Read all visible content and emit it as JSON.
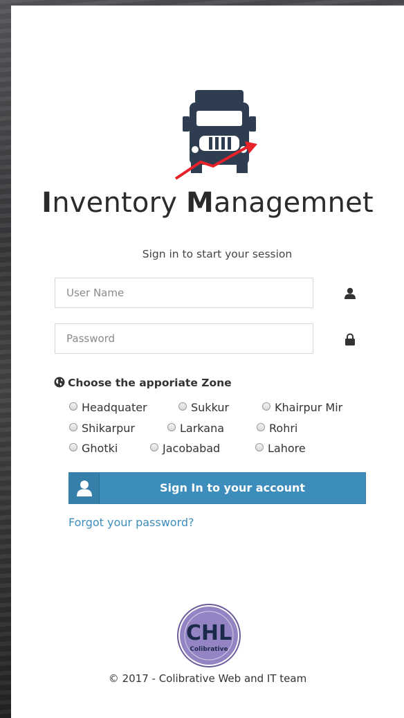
{
  "app": {
    "title_first_letter": "I",
    "title_first_rest": "nventory ",
    "title_second_letter": "M",
    "title_second_rest": "anagemnet",
    "subtitle": "Sign in to start your session"
  },
  "login": {
    "username_placeholder": "User Name",
    "username_value": "",
    "password_placeholder": "Password",
    "password_value": "",
    "zone_heading": "Choose the apporiate Zone",
    "zones": [
      "Headquater",
      "Sukkur",
      "Khairpur Mir",
      "Shikarpur",
      "Larkana",
      "Rohri",
      "Ghotki",
      "Jacobabad",
      "Lahore"
    ],
    "submit_label": "Sign In to your account",
    "forgot_label": "Forgot your password?"
  },
  "footer": {
    "seal_text": "CHL",
    "seal_subtext": "Colibrative",
    "copyright": "© 2017 - Colibrative Web and IT team"
  },
  "colors": {
    "primary": "#3c8dbc",
    "logo_dark": "#2e3e50",
    "logo_arrow": "#e8222a",
    "seal_purple": "#8a7ab8"
  },
  "icons": {
    "username": "user-icon",
    "password": "lock-icon",
    "zone": "globe-icon",
    "button": "user-icon"
  }
}
